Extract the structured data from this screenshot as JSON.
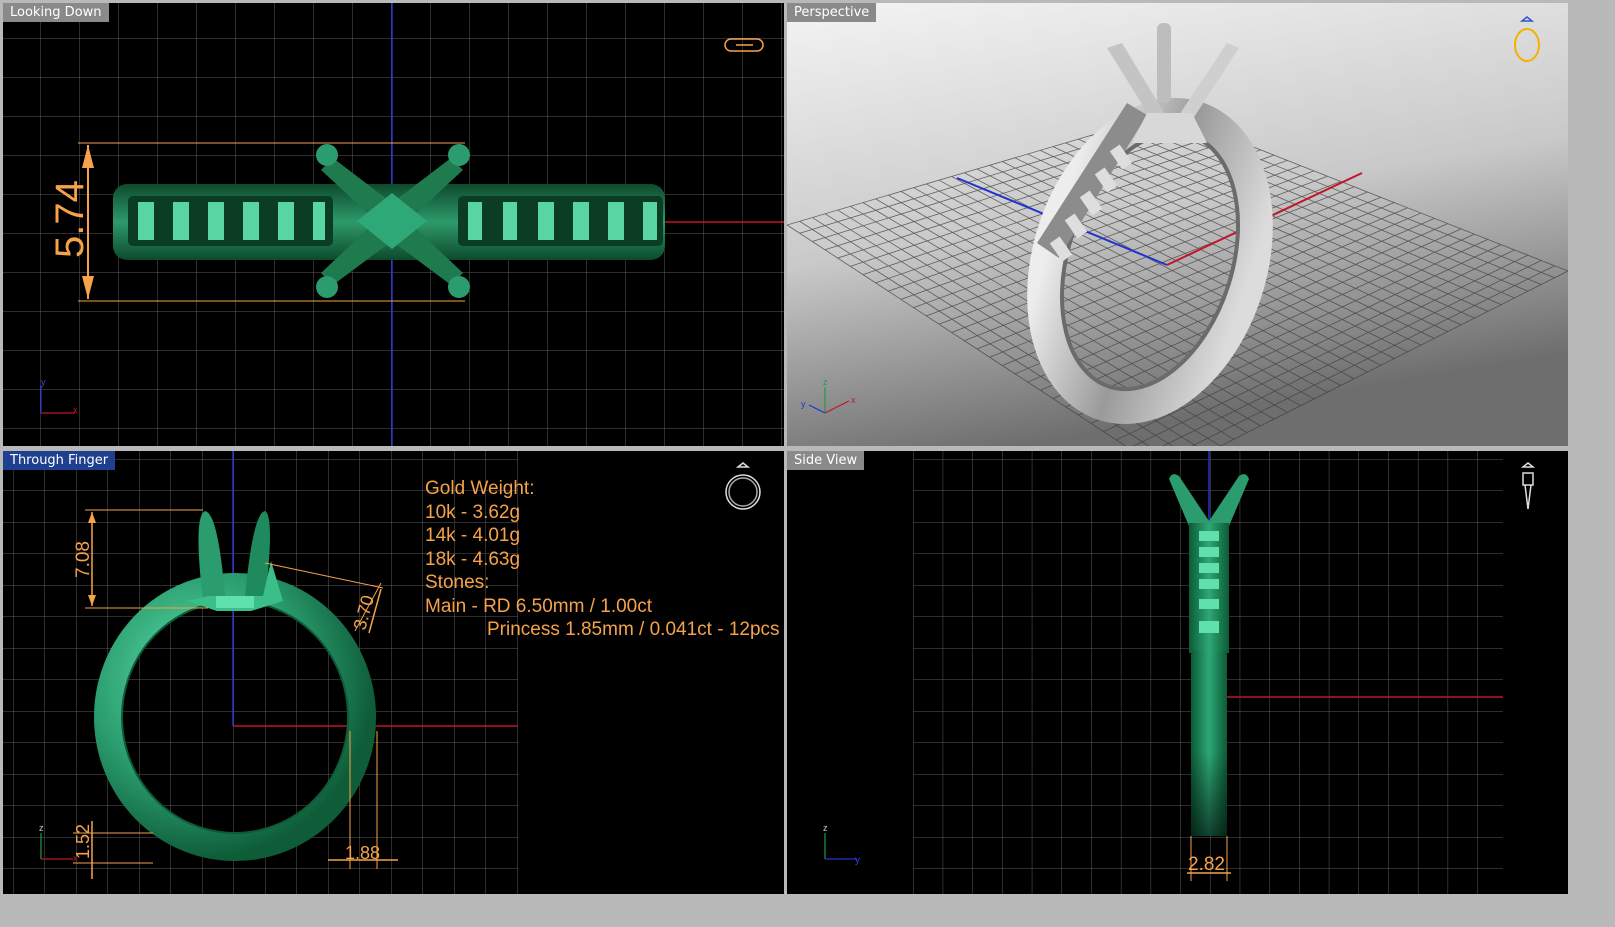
{
  "viewports": {
    "top_left": {
      "title": "Looking Down",
      "dimension": "5.74",
      "axis_x": "x",
      "axis_y": "y"
    },
    "top_right": {
      "title": "Perspective",
      "axis_x": "x",
      "axis_y": "y",
      "axis_z": "z"
    },
    "bottom_left": {
      "title": "Through Finger",
      "dims": {
        "height": "7.08",
        "angle": "3.70",
        "bottom": "1.52",
        "band": "1.88"
      },
      "axis_x": "x",
      "axis_z": "z",
      "notes": {
        "gold_weight": "Gold Weight:",
        "k10": "10k - 3.62g",
        "k14": "14k - 4.01g",
        "k18": "18k - 4.63g",
        "stones": "Stones:",
        "main": "Main - RD 6.50mm / 1.00ct",
        "side": "Princess 1.85mm / 0.041ct - 12pcs"
      }
    },
    "bottom_right": {
      "title": "Side View",
      "dimension": "2.82",
      "axis_y": "y",
      "axis_z": "z"
    }
  },
  "colors": {
    "viewport_bg": "#000000",
    "grid": "#5a5a5a",
    "ring_green": "#2a9c6e",
    "ring_dark": "#0c5a36",
    "dimension_orange": "#f5a24a",
    "axis_red": "#c0152a",
    "axis_blue": "#2233cc",
    "active_title_bg": "#1f3f8f",
    "inactive_title_bg": "#8a8a8a"
  },
  "icons": [
    "ring-top-icon",
    "ring-perspective-icon",
    "ring-front-icon",
    "ring-side-icon"
  ]
}
